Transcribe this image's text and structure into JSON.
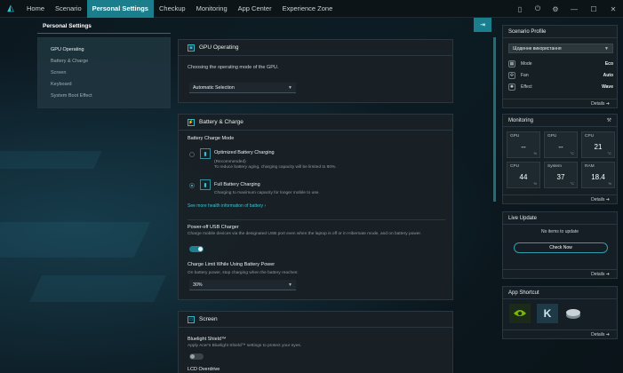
{
  "nav": {
    "tabs": [
      "Home",
      "Scenario",
      "Personal Settings",
      "Checkup",
      "Monitoring",
      "App Center",
      "Experience Zone"
    ],
    "active": "Personal Settings"
  },
  "page_title": "Personal Settings",
  "sidebar": {
    "items": [
      "GPU Operating",
      "Battery & Charge",
      "Screen",
      "Keyboard",
      "System Boot Effect"
    ],
    "active": "GPU Operating"
  },
  "gpu": {
    "title": "GPU Operating",
    "description": "Choosing the operating mode of the GPU.",
    "mode_value": "Automatic Selection"
  },
  "battery": {
    "title": "Battery & Charge",
    "mode_label": "Battery Charge Mode",
    "optimized_title": "Optimized Battery Charging",
    "optimized_rec": "(Recommended)",
    "optimized_desc": "To reduce battery aging, charging capacity will be limited to 80%.",
    "full_title": "Full Battery Charging",
    "full_desc": "Charging to maximum capacity for longer mobile to use.",
    "health_link": "See more health information of battery",
    "poweroff_title": "Power-off USB Charger",
    "poweroff_desc": "Charge mobile devices via the designated USB port even when the laptop is off or in Hibernate mode, and on battery power.",
    "limit_title": "Charge Limit While Using Battery Power",
    "limit_desc": "On battery power, stop charging when the battery reaches:",
    "limit_value": "30%"
  },
  "screen": {
    "title": "Screen",
    "bluelight_title": "Bluelight Shield™",
    "bluelight_desc": "Apply Acer's Bluelight Shield™ settings to protect your eyes.",
    "lcd_title": "LCD Overdrive"
  },
  "scenario_profile": {
    "title": "Scenario Profile",
    "selected": "Щоденне використання",
    "rows": [
      {
        "label": "Mode",
        "value": "Eco"
      },
      {
        "label": "Fan",
        "value": "Auto"
      },
      {
        "label": "Effect",
        "value": "Wave"
      }
    ],
    "details": "Details"
  },
  "monitoring": {
    "title": "Monitoring",
    "cells": [
      {
        "label": "GPU",
        "value": "--",
        "unit": "%"
      },
      {
        "label": "GPU",
        "value": "--",
        "unit": "°C"
      },
      {
        "label": "CPU",
        "value": "21",
        "unit": "°C"
      },
      {
        "label": "CPU",
        "value": "44",
        "unit": "%"
      },
      {
        "label": "System",
        "value": "37",
        "unit": "°C"
      },
      {
        "label": "RAM",
        "value": "18.4",
        "unit": "%"
      }
    ],
    "details": "Details"
  },
  "live_update": {
    "title": "Live Update",
    "status": "No items to update",
    "button": "Check Now",
    "details": "Details"
  },
  "app_shortcut": {
    "title": "App Shortcut",
    "apps": [
      "nvidia-app",
      "killer-app",
      "disk-app"
    ],
    "details": "Details"
  },
  "colors": {
    "accent": "#1b7e8c",
    "accent_light": "#3cc6d6"
  }
}
